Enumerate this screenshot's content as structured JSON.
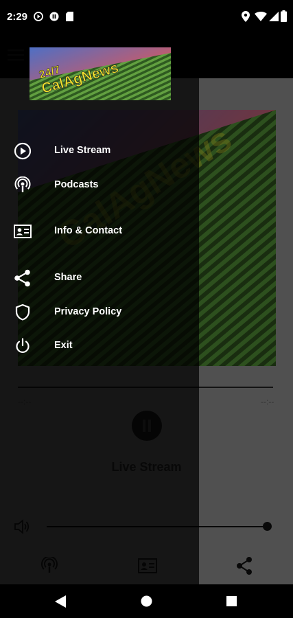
{
  "status_bar": {
    "time": "2:29",
    "left_icons": [
      "play-circle-icon",
      "pause-circle-icon",
      "sd-card-icon"
    ],
    "right_icons": [
      "location-icon",
      "wifi-icon",
      "cellular-icon",
      "battery-icon"
    ]
  },
  "app": {
    "logo_text_top": "24/7",
    "logo_text_main": "CalAgNews",
    "time_elapsed": "--:--",
    "time_total": "--:--",
    "now_playing_title": "Live Stream",
    "volume_level": 1.0,
    "bottom_tabs": [
      "podcast-icon",
      "contact-card-icon",
      "share-icon"
    ]
  },
  "drawer": {
    "items": [
      {
        "label": "Live Stream",
        "icon": "play-circle-icon"
      },
      {
        "label": "Podcasts",
        "icon": "podcast-icon"
      },
      {
        "label": "Info & Contact",
        "icon": "contact-card-icon"
      },
      {
        "label": "Share",
        "icon": "share-icon"
      },
      {
        "label": "Privacy Policy",
        "icon": "shield-icon"
      },
      {
        "label": "Exit",
        "icon": "power-icon"
      }
    ]
  },
  "colors": {
    "field_green": "#3f6b2a",
    "sky_pink": "#c65b6b",
    "sky_blue": "#5c6fb8",
    "logo_yellow": "#f0e22a"
  }
}
